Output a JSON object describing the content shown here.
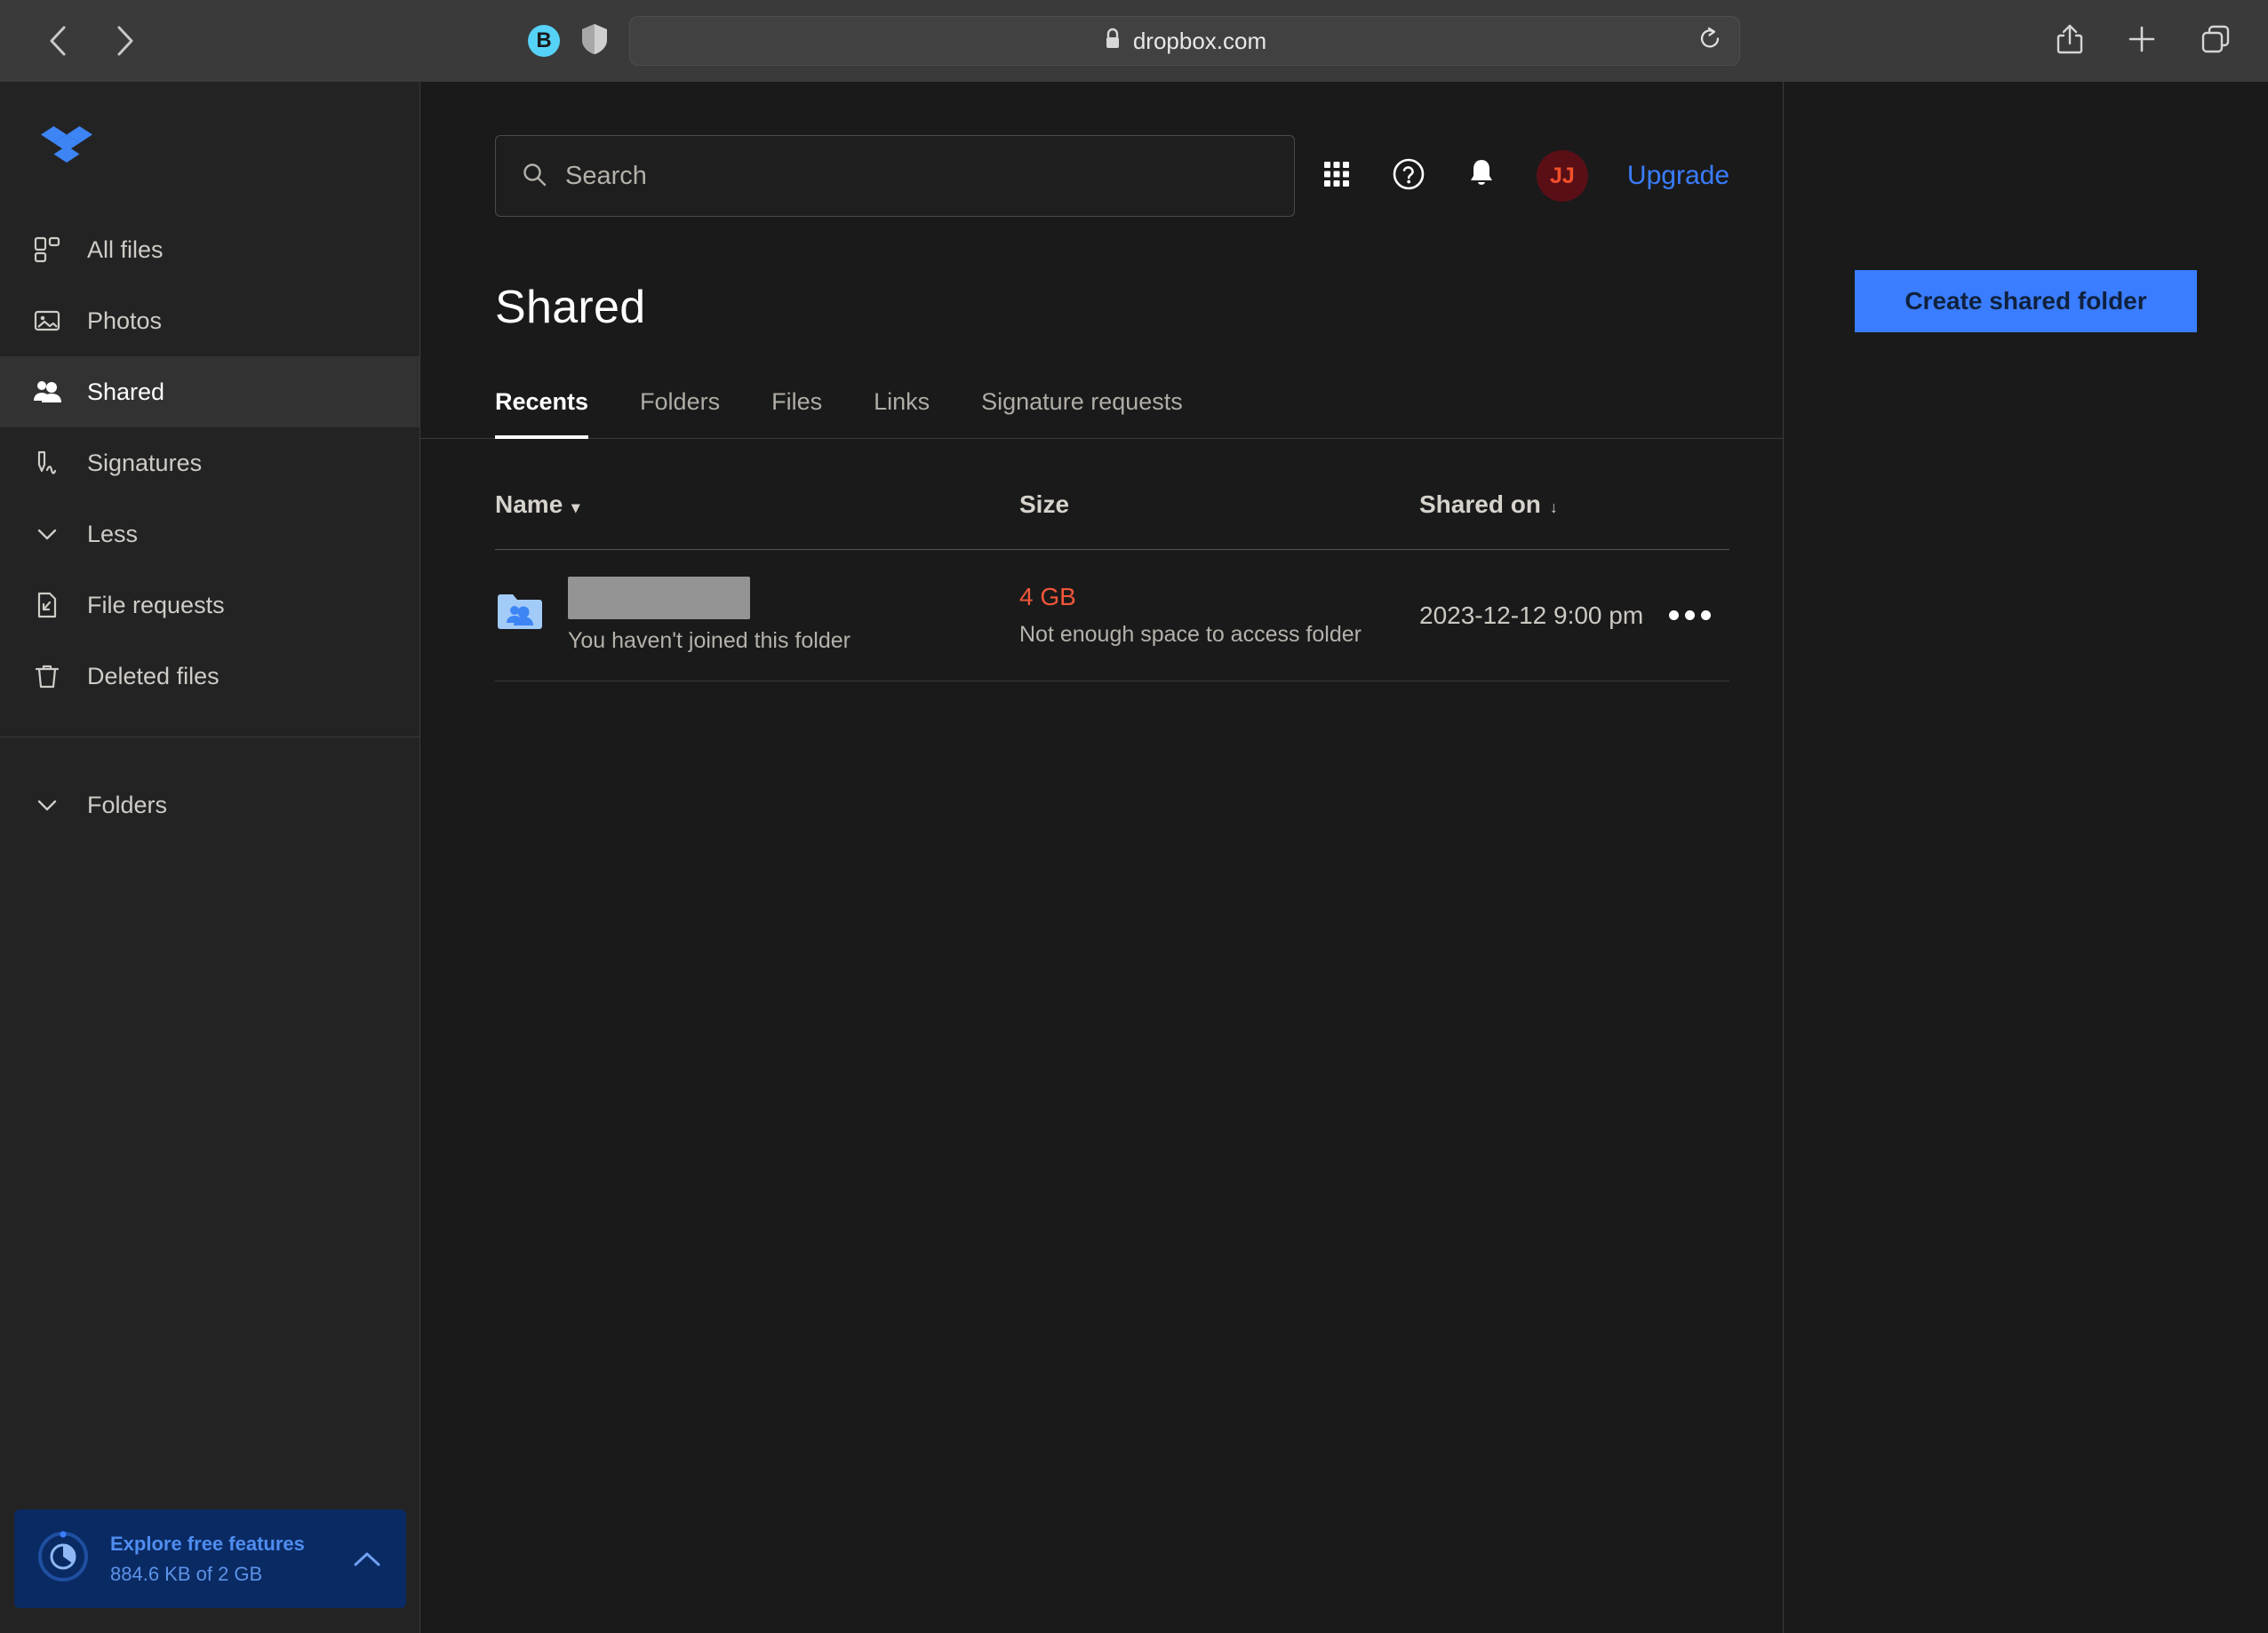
{
  "browser": {
    "back_icon": "chevron-left-icon",
    "forward_icon": "chevron-right-icon",
    "extension_badge": "B",
    "shield_icon": "shield-icon",
    "url": "dropbox.com",
    "lock_icon": "lock-icon",
    "reload_icon": "reload-icon",
    "share_icon": "share-icon",
    "new_tab_icon": "plus-icon",
    "tabs_icon": "tabs-overview-icon"
  },
  "sidebar": {
    "logo": "dropbox-logo",
    "items": [
      {
        "label": "All files",
        "icon": "all-files-icon",
        "active": false
      },
      {
        "label": "Photos",
        "icon": "photos-icon",
        "active": false
      },
      {
        "label": "Shared",
        "icon": "shared-people-icon",
        "active": true
      },
      {
        "label": "Signatures",
        "icon": "signature-pen-icon",
        "active": false
      },
      {
        "label": "Less",
        "icon": "chevron-down-icon",
        "active": false
      },
      {
        "label": "File requests",
        "icon": "file-request-icon",
        "active": false
      },
      {
        "label": "Deleted files",
        "icon": "trash-icon",
        "active": false
      }
    ],
    "folders_section": {
      "label": "Folders",
      "icon": "chevron-down-icon"
    },
    "storage": {
      "title": "Explore free features",
      "usage": "884.6 KB of 2 GB",
      "ring_icon": "storage-pie-icon",
      "collapse_icon": "chevron-up-icon"
    }
  },
  "header": {
    "search": {
      "placeholder": "Search",
      "value": "",
      "icon": "search-icon"
    },
    "apps_icon": "apps-grid-icon",
    "help_icon": "help-circle-icon",
    "notifications_icon": "bell-icon",
    "avatar_initials": "JJ",
    "upgrade_label": "Upgrade"
  },
  "main": {
    "title": "Shared",
    "tabs": [
      {
        "label": "Recents",
        "active": true
      },
      {
        "label": "Folders",
        "active": false
      },
      {
        "label": "Files",
        "active": false
      },
      {
        "label": "Links",
        "active": false
      },
      {
        "label": "Signature requests",
        "active": false
      }
    ],
    "table": {
      "columns": [
        {
          "label": "Name",
          "sort_indicator": "▾"
        },
        {
          "label": "Size",
          "sort_indicator": ""
        },
        {
          "label": "Shared on",
          "sort_indicator": "↓"
        }
      ],
      "rows": [
        {
          "icon": "shared-folder-icon",
          "name": "",
          "name_redacted": true,
          "name_note": "You haven't joined this folder",
          "size": "4 GB",
          "size_note": "Not enough space to access folder",
          "shared_on": "2023-12-12 9:00 pm",
          "menu_icon": "more-options-icon"
        }
      ]
    }
  },
  "right_panel": {
    "create_button": "Create shared folder"
  },
  "colors": {
    "accent_blue": "#3a7dff",
    "brand_blue": "#3d84f5",
    "warning_red": "#f2563a",
    "sidebar_bg": "#232323",
    "content_bg": "#1a1a1a",
    "chrome_bg": "#3a3a3a"
  }
}
